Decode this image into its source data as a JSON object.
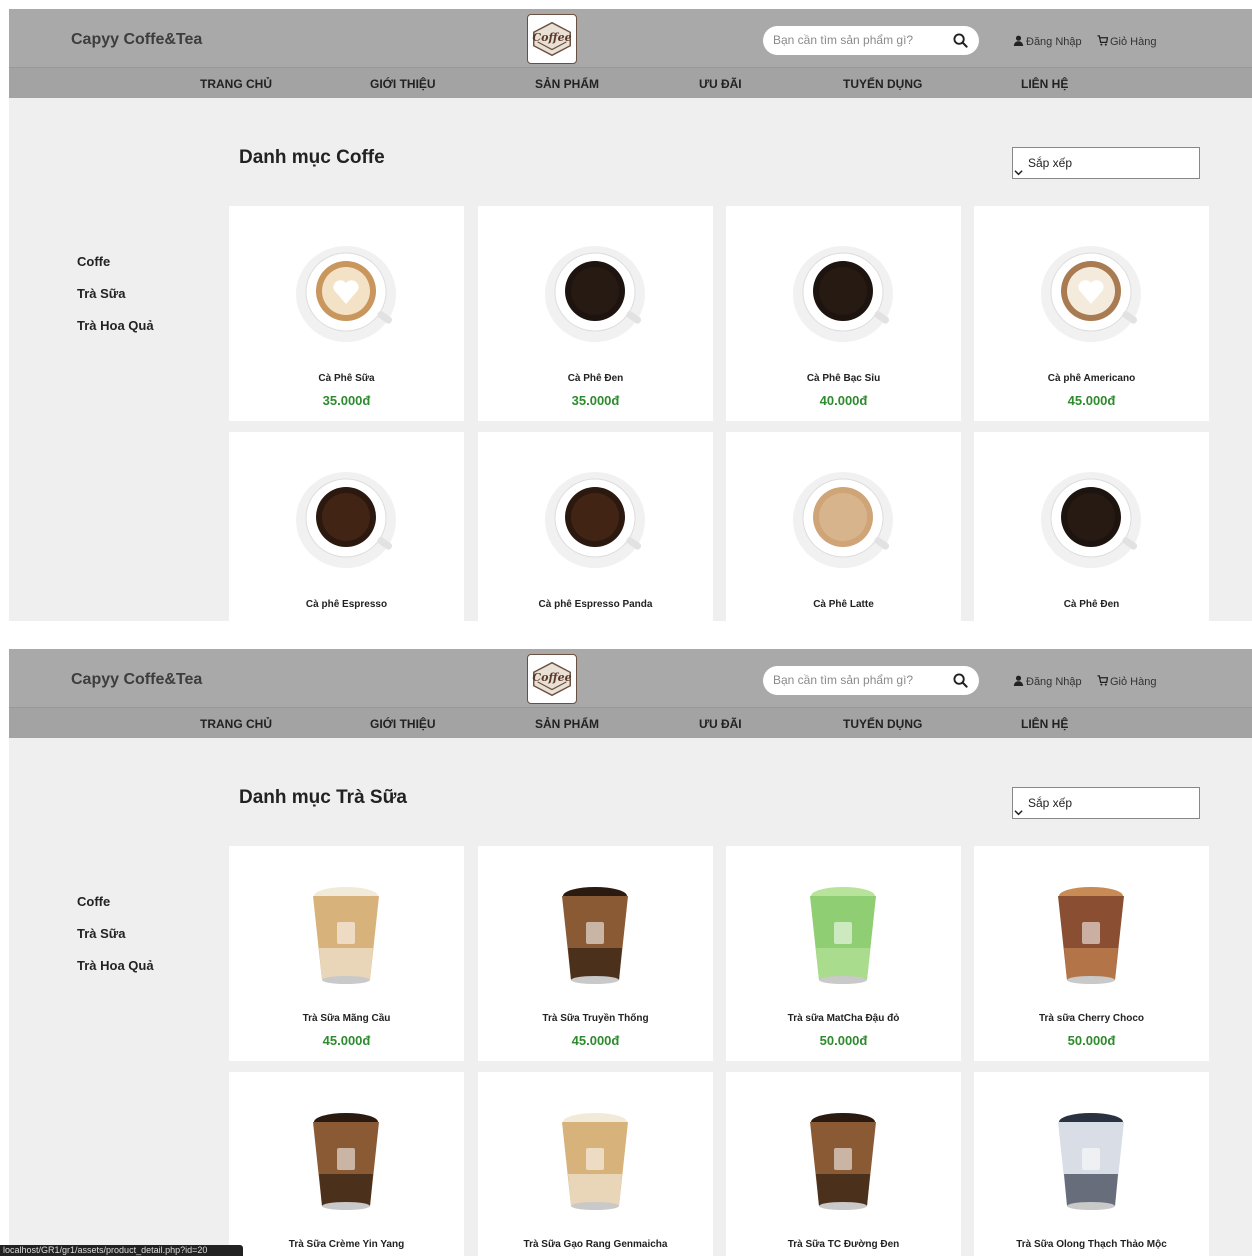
{
  "header": {
    "brand": "Capyy Coffe&Tea",
    "logo_text": "Coffee",
    "search_placeholder": "Bạn cần tìm sản phẩm gì?",
    "login": "Đăng Nhập",
    "cart": "Giỏ Hàng"
  },
  "nav": [
    "TRANG CHỦ",
    "GIỚI THIỆU",
    "SẢN PHẨM",
    "ƯU ĐÃI",
    "TUYỂN DỤNG",
    "LIÊN HỆ"
  ],
  "sidebar": [
    "Coffe",
    "Trà Sữa",
    "Trà Hoa Quả"
  ],
  "sort_label": "Sắp xếp",
  "screens": [
    {
      "title": "Danh mục Coffe",
      "products": [
        {
          "name": "Cà Phê Sữa",
          "price": "35.000đ",
          "kind": "latte"
        },
        {
          "name": "Cà Phê Đen",
          "price": "35.000đ",
          "kind": "black"
        },
        {
          "name": "Cà Phê Bạc Sỉu",
          "price": "40.000đ",
          "kind": "black"
        },
        {
          "name": "Cà phê Americano",
          "price": "45.000đ",
          "kind": "art"
        },
        {
          "name": "Cà phê Espresso",
          "price": "",
          "kind": "espresso"
        },
        {
          "name": "Cà phê Espresso Panda",
          "price": "",
          "kind": "espresso"
        },
        {
          "name": "Cà Phê Latte",
          "price": "",
          "kind": "foam"
        },
        {
          "name": "Cà Phê Đen",
          "price": "",
          "kind": "black"
        }
      ]
    },
    {
      "title": "Danh mục Trà Sữa",
      "products": [
        {
          "name": "Trà Sữa Mãng Cầu",
          "price": "45.000đ",
          "kind": "milk"
        },
        {
          "name": "Trà Sữa Truyền Thống",
          "price": "45.000đ",
          "kind": "boba"
        },
        {
          "name": "Trà sữa MatCha Đậu đỏ",
          "price": "50.000đ",
          "kind": "matcha"
        },
        {
          "name": "Trà sữa Cherry Choco",
          "price": "50.000đ",
          "kind": "choco"
        },
        {
          "name": "Trà Sữa Crème Yin Yang",
          "price": "",
          "kind": "boba"
        },
        {
          "name": "Trà Sữa Gạo Rang Genmaicha",
          "price": "",
          "kind": "milk"
        },
        {
          "name": "Trà Sữa TC Đường Đen",
          "price": "",
          "kind": "boba"
        },
        {
          "name": "Trà Sữa Olong Thạch Thảo Mộc",
          "price": "",
          "kind": "oolong"
        }
      ]
    }
  ],
  "status_url": "localhost/GR1/gr1/assets/product_detail.php?id=20",
  "colors": {
    "header": "#a9a9a9",
    "nav": "#a3a3a3",
    "price": "#2e8b2e",
    "background": "#efefef"
  }
}
